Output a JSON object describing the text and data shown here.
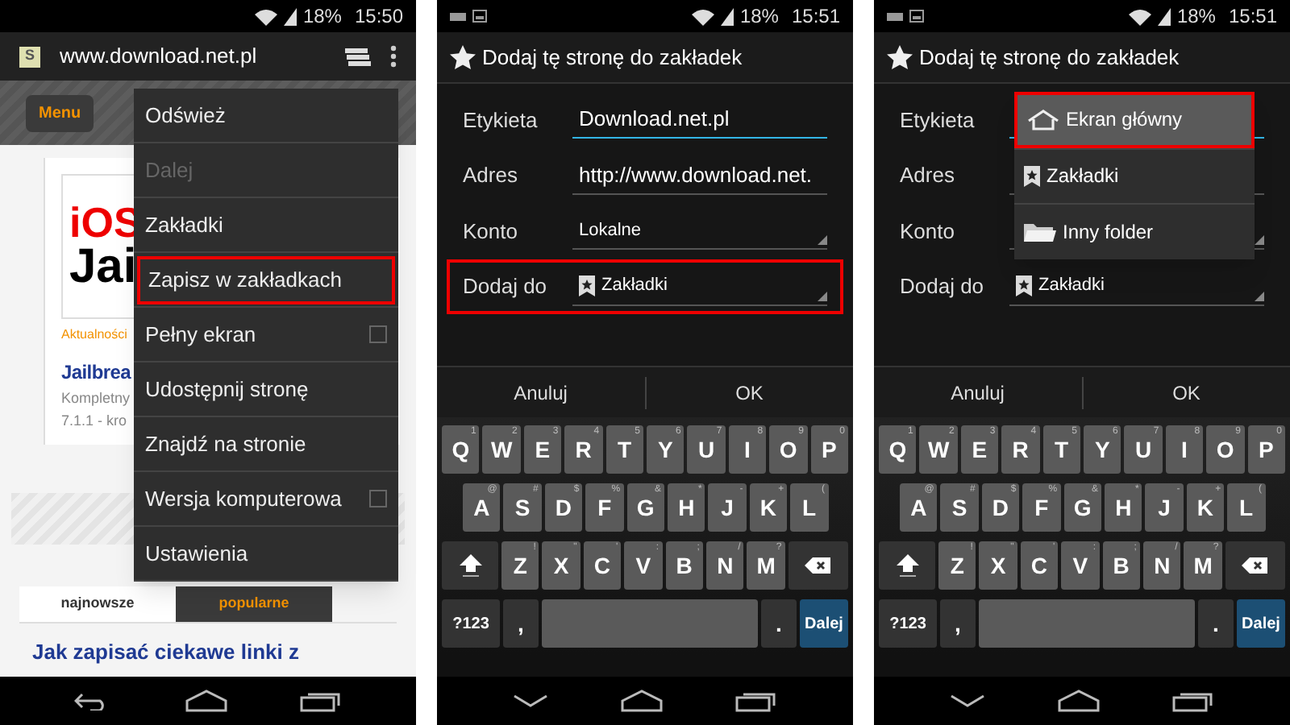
{
  "panels": [
    {
      "kind": "browser",
      "status_bar": {
        "notifications": false,
        "battery": "18%",
        "time": "15:50"
      },
      "toolbar": {
        "favicon": "S",
        "url": "www.download.net.pl"
      },
      "page": {
        "menu_button": "Menu",
        "image_text": [
          "iOS",
          "Jai"
        ],
        "category": "Aktualności",
        "title": "Jailbrea",
        "excerpt": [
          "Kompletny",
          "7.1.1 - kro"
        ],
        "tabs": [
          {
            "label": "najnowsze",
            "selected": true
          },
          {
            "label": "popularne",
            "selected": false
          }
        ],
        "headline": "Jak zapisać ciekawe linki z"
      },
      "menu": [
        {
          "label": "Odśwież",
          "kind": "action",
          "disabled": false,
          "highlighted": false
        },
        {
          "label": "Dalej",
          "kind": "action",
          "disabled": true,
          "highlighted": false
        },
        {
          "label": "Zakładki",
          "kind": "action",
          "disabled": false,
          "highlighted": false
        },
        {
          "label": "Zapisz w zakładkach",
          "kind": "action",
          "disabled": false,
          "highlighted": true
        },
        {
          "label": "Pełny ekran",
          "kind": "toggle",
          "checked": false,
          "disabled": false,
          "highlighted": false
        },
        {
          "label": "Udostępnij stronę",
          "kind": "action",
          "disabled": false,
          "highlighted": false
        },
        {
          "label": "Znajdź na stronie",
          "kind": "action",
          "disabled": false,
          "highlighted": false
        },
        {
          "label": "Wersja komputerowa",
          "kind": "toggle",
          "checked": false,
          "disabled": false,
          "highlighted": false
        },
        {
          "label": "Ustawienia",
          "kind": "action",
          "disabled": false,
          "highlighted": false
        }
      ]
    },
    {
      "kind": "bookmark_dialog",
      "status_bar": {
        "notifications": true,
        "battery": "18%",
        "time": "15:51"
      },
      "title": "Dodaj tę stronę do zakładek",
      "fields": [
        {
          "label": "Etykieta",
          "kind": "text",
          "value": "Download.net.pl",
          "focused": true,
          "highlighted": false
        },
        {
          "label": "Adres",
          "kind": "text",
          "value": "http://www.download.net.",
          "focused": false,
          "highlighted": false
        },
        {
          "label": "Konto",
          "kind": "dropdown",
          "value": "Lokalne",
          "focused": false,
          "highlighted": false
        },
        {
          "label": "Dodaj do",
          "kind": "bookmark_dropdown",
          "value": "Zakładki",
          "focused": false,
          "highlighted": true
        }
      ],
      "buttons": [
        "Anuluj",
        "OK"
      ],
      "keyboard": {
        "rows": [
          [
            {
              "key": "Q",
              "hint": "1"
            },
            {
              "key": "W",
              "hint": "2"
            },
            {
              "key": "E",
              "hint": "3"
            },
            {
              "key": "R",
              "hint": "4"
            },
            {
              "key": "T",
              "hint": "5"
            },
            {
              "key": "Y",
              "hint": "6"
            },
            {
              "key": "U",
              "hint": "7"
            },
            {
              "key": "I",
              "hint": "8"
            },
            {
              "key": "O",
              "hint": "9"
            },
            {
              "key": "P",
              "hint": "0"
            }
          ],
          [
            {
              "key": "A",
              "hint": "@"
            },
            {
              "key": "S",
              "hint": "#"
            },
            {
              "key": "D",
              "hint": "$"
            },
            {
              "key": "F",
              "hint": "%"
            },
            {
              "key": "G",
              "hint": "&"
            },
            {
              "key": "H",
              "hint": "*"
            },
            {
              "key": "J",
              "hint": "-"
            },
            {
              "key": "K",
              "hint": "+"
            },
            {
              "key": "L",
              "hint": "("
            }
          ],
          [
            {
              "key": "Z",
              "hint": "!"
            },
            {
              "key": "X",
              "hint": "\""
            },
            {
              "key": "C",
              "hint": "'"
            },
            {
              "key": "V",
              "hint": ":"
            },
            {
              "key": "B",
              "hint": ";"
            },
            {
              "key": "N",
              "hint": "/"
            },
            {
              "key": "M",
              "hint": "?"
            }
          ]
        ],
        "symbols": "?123",
        "comma": ",",
        "period": ".",
        "action": "Dalej"
      }
    },
    {
      "kind": "bookmark_dialog",
      "status_bar": {
        "notifications": true,
        "battery": "18%",
        "time": "15:51"
      },
      "title": "Dodaj tę stronę do zakładek",
      "fields": [
        {
          "label": "Etykieta",
          "kind": "text",
          "focused": true,
          "highlighted": false
        },
        {
          "label": "Adres",
          "kind": "text",
          "focused": false,
          "highlighted": false
        },
        {
          "label": "Konto",
          "kind": "dropdown",
          "focused": false,
          "highlighted": false
        },
        {
          "label": "Dodaj do",
          "kind": "bookmark_dropdown",
          "value": "Zakładki",
          "focused": false,
          "highlighted": false
        }
      ],
      "popup": [
        {
          "label": "Ekran główny",
          "kind": "home",
          "selected": true
        },
        {
          "label": "Zakładki",
          "kind": "bookmark",
          "selected": false
        },
        {
          "label": "Inny folder",
          "kind": "folder",
          "selected": false
        }
      ],
      "buttons": [
        "Anuluj",
        "OK"
      ],
      "keyboard": {
        "rows": [
          [
            {
              "key": "Q",
              "hint": "1"
            },
            {
              "key": "W",
              "hint": "2"
            },
            {
              "key": "E",
              "hint": "3"
            },
            {
              "key": "R",
              "hint": "4"
            },
            {
              "key": "T",
              "hint": "5"
            },
            {
              "key": "Y",
              "hint": "6"
            },
            {
              "key": "U",
              "hint": "7"
            },
            {
              "key": "I",
              "hint": "8"
            },
            {
              "key": "O",
              "hint": "9"
            },
            {
              "key": "P",
              "hint": "0"
            }
          ],
          [
            {
              "key": "A",
              "hint": "@"
            },
            {
              "key": "S",
              "hint": "#"
            },
            {
              "key": "D",
              "hint": "$"
            },
            {
              "key": "F",
              "hint": "%"
            },
            {
              "key": "G",
              "hint": "&"
            },
            {
              "key": "H",
              "hint": "*"
            },
            {
              "key": "J",
              "hint": "-"
            },
            {
              "key": "K",
              "hint": "+"
            },
            {
              "key": "L",
              "hint": "("
            }
          ],
          [
            {
              "key": "Z",
              "hint": "!"
            },
            {
              "key": "X",
              "hint": "\""
            },
            {
              "key": "C",
              "hint": "'"
            },
            {
              "key": "V",
              "hint": ":"
            },
            {
              "key": "B",
              "hint": ";"
            },
            {
              "key": "N",
              "hint": "/"
            },
            {
              "key": "M",
              "hint": "?"
            }
          ]
        ],
        "symbols": "?123",
        "comma": ",",
        "period": ".",
        "action": "Dalej"
      }
    }
  ]
}
